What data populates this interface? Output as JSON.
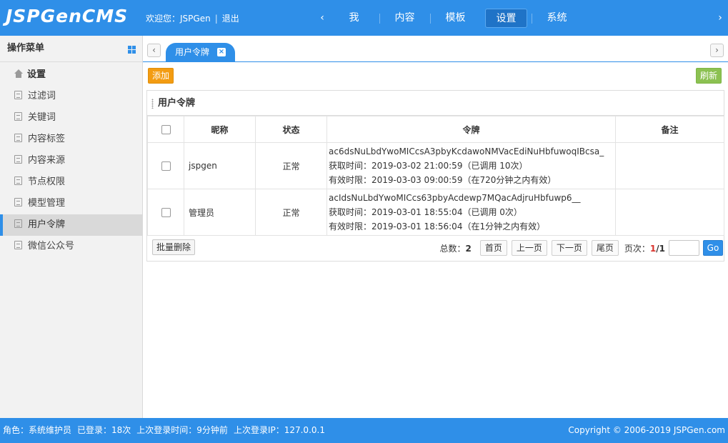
{
  "header": {
    "logo": "JSPGenCMS",
    "welcome": "欢迎您：JSPGen",
    "logout": "退出",
    "nav_prev": "‹",
    "nav_next": "›",
    "nav": [
      {
        "label": "我"
      },
      {
        "label": "内容"
      },
      {
        "label": "模板"
      },
      {
        "label": "设置",
        "active": true
      },
      {
        "label": "系统"
      }
    ]
  },
  "sidebar": {
    "title": "操作菜单",
    "root": "设置",
    "items": [
      {
        "label": "过滤词"
      },
      {
        "label": "关键词"
      },
      {
        "label": "内容标签"
      },
      {
        "label": "内容来源"
      },
      {
        "label": "节点权限"
      },
      {
        "label": "模型管理"
      },
      {
        "label": "用户令牌",
        "active": true
      },
      {
        "label": "微信公众号"
      }
    ]
  },
  "tabs": {
    "prev": "‹",
    "next": "›",
    "active_label": "用户令牌",
    "close": "×"
  },
  "toolbar": {
    "add_label": "添加",
    "refresh_label": "刷新"
  },
  "panel": {
    "title": "用户令牌",
    "columns": [
      "昵称",
      "状态",
      "令牌",
      "备注"
    ],
    "rows": [
      {
        "nickname": "jspgen",
        "status": "正常",
        "token": "ac6dsNuLbdYwoMICcsA3pbyKcdawoNMVacEdiNuHbfuwoqIBcsa_",
        "fetch_time": "获取时间：2019-03-02 21:00:59（已调用 10次）",
        "valid_time": "有效时限：2019-03-03 09:00:59（在720分钟之内有效）",
        "note": ""
      },
      {
        "nickname": "管理员",
        "status": "正常",
        "token": "acIdsNuLbdYwoMICcs63pbyAcdewp7MQacAdjruHbfuwp6__",
        "fetch_time": "获取时间：2019-03-01 18:55:04（已调用 0次）",
        "valid_time": "有效时限：2019-03-01 18:56:04（在1分钟之内有效）",
        "note": ""
      }
    ],
    "bulk_delete": "批量删除",
    "pager": {
      "total_label": "总数：",
      "total": "2",
      "first": "首页",
      "prev": "上一页",
      "next": "下一页",
      "last": "尾页",
      "page_label": "页次：",
      "current": "1",
      "slash": "/",
      "pages": "1",
      "go": "Go"
    }
  },
  "footer": {
    "role": "角色：系统维护员",
    "logins": "已登录：18次",
    "last_time": "上次登录时间：9分钟前",
    "last_ip": "上次登录IP：127.0.0.1",
    "copyright": "Copyright © 2006-2019 JSPGen.com"
  }
}
